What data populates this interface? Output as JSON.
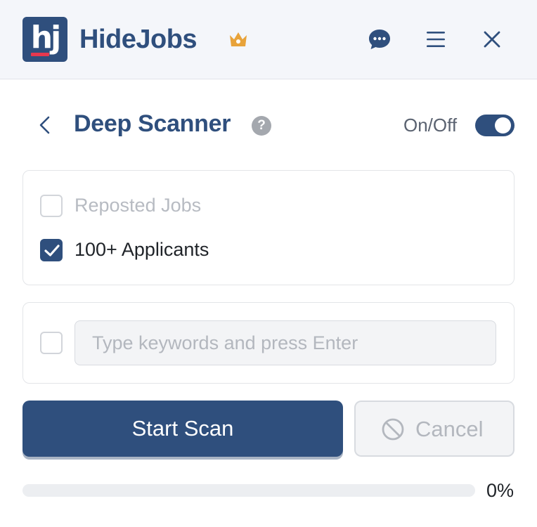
{
  "app": {
    "brand_name": "HideJobs",
    "logo_text": "hj",
    "icons": {
      "crown": "crown-icon",
      "chat": "chat-bubble-icon",
      "menu": "hamburger-menu-icon",
      "close": "close-icon"
    }
  },
  "panel": {
    "title": "Deep Scanner",
    "help_glyph": "?",
    "toggle_label": "On/Off",
    "toggle_on": true
  },
  "filters": {
    "reposted": {
      "label": "Reposted Jobs",
      "checked": false,
      "disabled": true
    },
    "applicants": {
      "label": "100+ Applicants",
      "checked": true
    }
  },
  "keywords": {
    "checked": false,
    "value": "",
    "placeholder": "Type keywords and press Enter"
  },
  "actions": {
    "start_label": "Start Scan",
    "cancel_label": "Cancel",
    "cancel_disabled": true
  },
  "progress": {
    "percent": 0,
    "label": "0%"
  },
  "colors": {
    "primary": "#2f4f7d",
    "accent_red": "#e6384f",
    "crown_gold": "#e8a33a",
    "muted_text": "#b3b7be"
  }
}
